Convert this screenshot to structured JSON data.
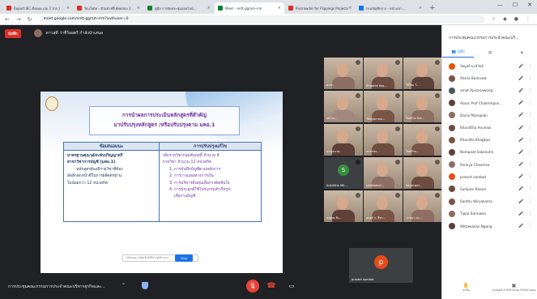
{
  "browser": {
    "tabs": [
      {
        "label": "Report IEC ทั้งหมด เล่ม 1 (กก.)",
        "color": "#d93025",
        "active": false
      },
      {
        "label": "YouTube - ตัวอย่างที่ได้ทดสอบ 2 ...",
        "color": "#d93025",
        "active": false
      },
      {
        "label": "คู่มือ การจัดประชุมออนไลน์...",
        "color": "#188038",
        "active": false
      },
      {
        "label": "Meet – nntt-ggmm-rrm",
        "color": "#00832d",
        "active": true
      },
      {
        "label": "Riscrowder for Flippings Projects",
        "color": "#d93025",
        "active": false
      },
      {
        "label": "กรมบัญชีกลาง - หน้าแรก ...",
        "color": "#1a73e8",
        "active": false
      }
    ],
    "url": "meet.google.com/nntt-ggmm-rrm?authuser=0"
  },
  "meet": {
    "rec_badge": "บันทึก",
    "presenter_text": "ดาวสุดี ว่าที่ร้อยตรี กำลังนำเสนอ",
    "meeting_title": "การประชุมคณะกรรมการประจำคณะบริหารธุรกิจและ...",
    "slide": {
      "title_line1": "การนำผลการประเมินหลักสูตรที่สำคัญ",
      "title_line2": "มาปรับปรุงหลักสูตร /หรือปรับปรุงตาม มคอ.1",
      "col1_header": "ข้อเสนอแนะ",
      "col2_header": "การปรับปรุงแก้ไข",
      "col1_lines": [
        "มาตรฐานคุณวุฒิระดับปริญญาตรี",
        "สาขาวิชาการบัญชี (มคอ.1)",
        "- หลักสูตรต้องมีรายวิชาที่ต้อง",
        "อัพสิกสกหน้าที่ในการผลิตตรฐาน",
        "ไม่น้อยกว่า 12 หน่วยกิต"
      ],
      "col2_lines": [
        "เพิ่มรายวิชากลุ่มสัมฤทธิ์ จำนวน 4",
        "รายวิชา  จำนวน  12  หน่วยกิต",
        "1. การบันทึกบัญชีตามหลักการ",
        "2. การวางแผนทางการเงิน",
        "3. การบริหารต้นทุนเพื่อการตัดสินใจ",
        "4. การประยุกต์ใช้โปรแกรมสำเร็จรูป",
        "เพื่องานบัญชี"
      ],
      "footer_text": "ได้เสนอความคิดเห็นให้ที่ประชุมพิจารณา",
      "footer_btn": "Stop"
    },
    "tiles": [
      {
        "name": "มาลา",
        "color": "#8d6e63"
      },
      {
        "name": "Bhaonid Asa...",
        "color": "#6d4c41"
      },
      {
        "name": "ใจไทย T...",
        "color": "#5d4037"
      },
      {
        "name": "เสาวน...",
        "color": "#a1887f"
      },
      {
        "name": "Tittiyan sai...",
        "color": "#795548"
      },
      {
        "name": "ใจคล้าย Sut...",
        "color": "#8d6e63"
      },
      {
        "name": "กาญจนาด...",
        "color": "#5d4037"
      },
      {
        "name": "อรวรรณ...",
        "color": "#6d4c41"
      },
      {
        "name": "ใจคล้าย...",
        "color": "#795548"
      },
      {
        "name": "Sukditha Wil...",
        "letter": "S",
        "color": "#388e3c"
      },
      {
        "name": "sreekamol...",
        "color": "#8d6e63"
      },
      {
        "name": "Saranwel...",
        "color": "#6d4c41"
      },
      {
        "name": "ยงยุทธ สิง...",
        "color": "#5d4037"
      },
      {
        "name": "อนงค์ ร. สีหา...",
        "color": "#795548"
      },
      {
        "name": "วรรณา คง...",
        "color": "#8d6e63"
      }
    ],
    "big_tile": {
      "letter": "p",
      "name": "prasert sombat"
    }
  },
  "panel": {
    "title": "การประชุมคณะกรรมการประจำคณะบริ...",
    "tab_people": "(26)",
    "participants": [
      {
        "name": "ไพบูลย์ มะลิวัลย์",
        "color": "#e65100"
      },
      {
        "name": "Alisna Boonsaw",
        "color": "#795548"
      },
      {
        "name": "amat Apisanawong",
        "color": "#455a64"
      },
      {
        "name": "Assoc Prof Chalermpon...",
        "color": "#5d4037"
      },
      {
        "name": "Danai Manopian",
        "color": "#8d6e63"
      },
      {
        "name": "Khanittha Anumas",
        "color": "#6d4c41"
      },
      {
        "name": "Khanitta Khagkan",
        "color": "#795548"
      },
      {
        "name": "Nompaat Sakonutin",
        "color": "#5d4037"
      },
      {
        "name": "Parinya Chaemsa",
        "color": "#8d6e63"
      },
      {
        "name": "prasert sombat",
        "color": "#e64a19"
      },
      {
        "name": "Sampan Rassul",
        "color": "#6d4c41"
      },
      {
        "name": "Santhu Wiryakama",
        "color": "#795548"
      },
      {
        "name": "Tippa Sarinwan",
        "color": "#8d6e63"
      },
      {
        "name": "Wittawasan Ngang",
        "color": "#5d4037"
      }
    ],
    "bottom_raise": "ยกมือ",
    "bottom_present": "นายยุทธ์ กำลังนำเสนอ กำลังนำเสนอ"
  }
}
